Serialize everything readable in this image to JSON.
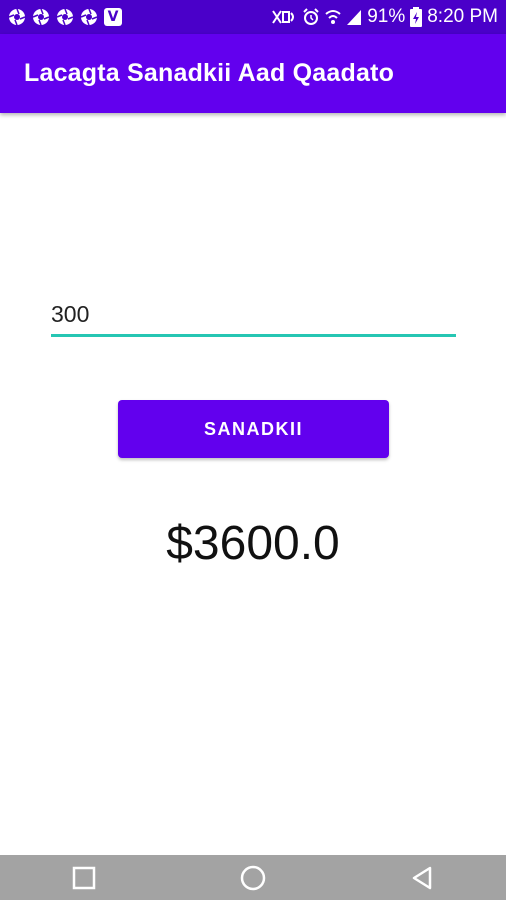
{
  "status_bar": {
    "notification_icons": [
      "aperture-icon",
      "aperture-icon",
      "aperture-icon",
      "aperture-icon",
      "v-app-icon"
    ],
    "v_icon_letter": "V",
    "battery": "91%",
    "time": "8:20 PM"
  },
  "app_bar": {
    "title": "Lacagta Sanadkii Aad Qaadato"
  },
  "form": {
    "amount_value": "300",
    "button_label": "SANADKII"
  },
  "result": {
    "text": "$3600.0"
  },
  "colors": {
    "status_bar": "#4a00c9",
    "app_bar": "#6200ee",
    "button": "#6200ee",
    "input_underline": "#26c6b3",
    "nav_bar": "#a3a3a3"
  },
  "nav_bar": {
    "buttons": [
      "recents-square-icon",
      "home-circle-icon",
      "back-triangle-icon"
    ]
  }
}
